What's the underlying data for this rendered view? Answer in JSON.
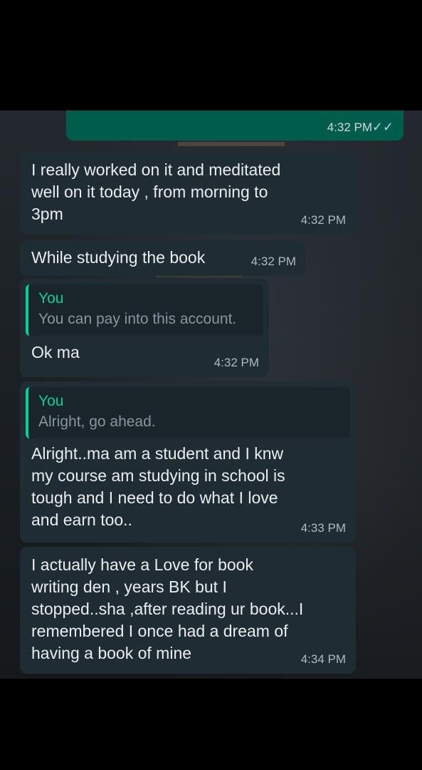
{
  "messages": [
    {
      "id": "m0",
      "direction": "outgoing",
      "time": "4:32 PM",
      "status_icon": "double-check-icon",
      "status_glyph": "✓✓"
    },
    {
      "id": "m1",
      "direction": "incoming",
      "text": "I really worked on it and meditated\nwell on it today , from morning to\n3pm",
      "time": "4:32 PM"
    },
    {
      "id": "m2",
      "direction": "incoming",
      "text": "While studying the book",
      "time": "4:32 PM"
    },
    {
      "id": "m3",
      "direction": "incoming",
      "quote": {
        "author": "You",
        "text": "You can pay into this account."
      },
      "text": "Ok ma",
      "time": "4:32 PM"
    },
    {
      "id": "m4",
      "direction": "incoming",
      "quote": {
        "author": "You",
        "text": "Alright, go ahead."
      },
      "text": "Alright..ma am a student and I knw\nmy course am studying in school is\ntough and I need to do what I love\nand earn too..",
      "time": "4:33 PM"
    },
    {
      "id": "m5",
      "direction": "incoming",
      "text": "I actually have a Love for book\nwriting den , years BK but I\nstopped..sha ,after reading ur book...I\nremembered I once had a dream of\nhaving a book of mine",
      "time": "4:34 PM"
    }
  ],
  "colors": {
    "incoming_bubble": "#1f2c34",
    "outgoing_bubble": "#005c4b",
    "quote_accent": "#06cf9c",
    "read_ticks": "#a6d6f0"
  }
}
